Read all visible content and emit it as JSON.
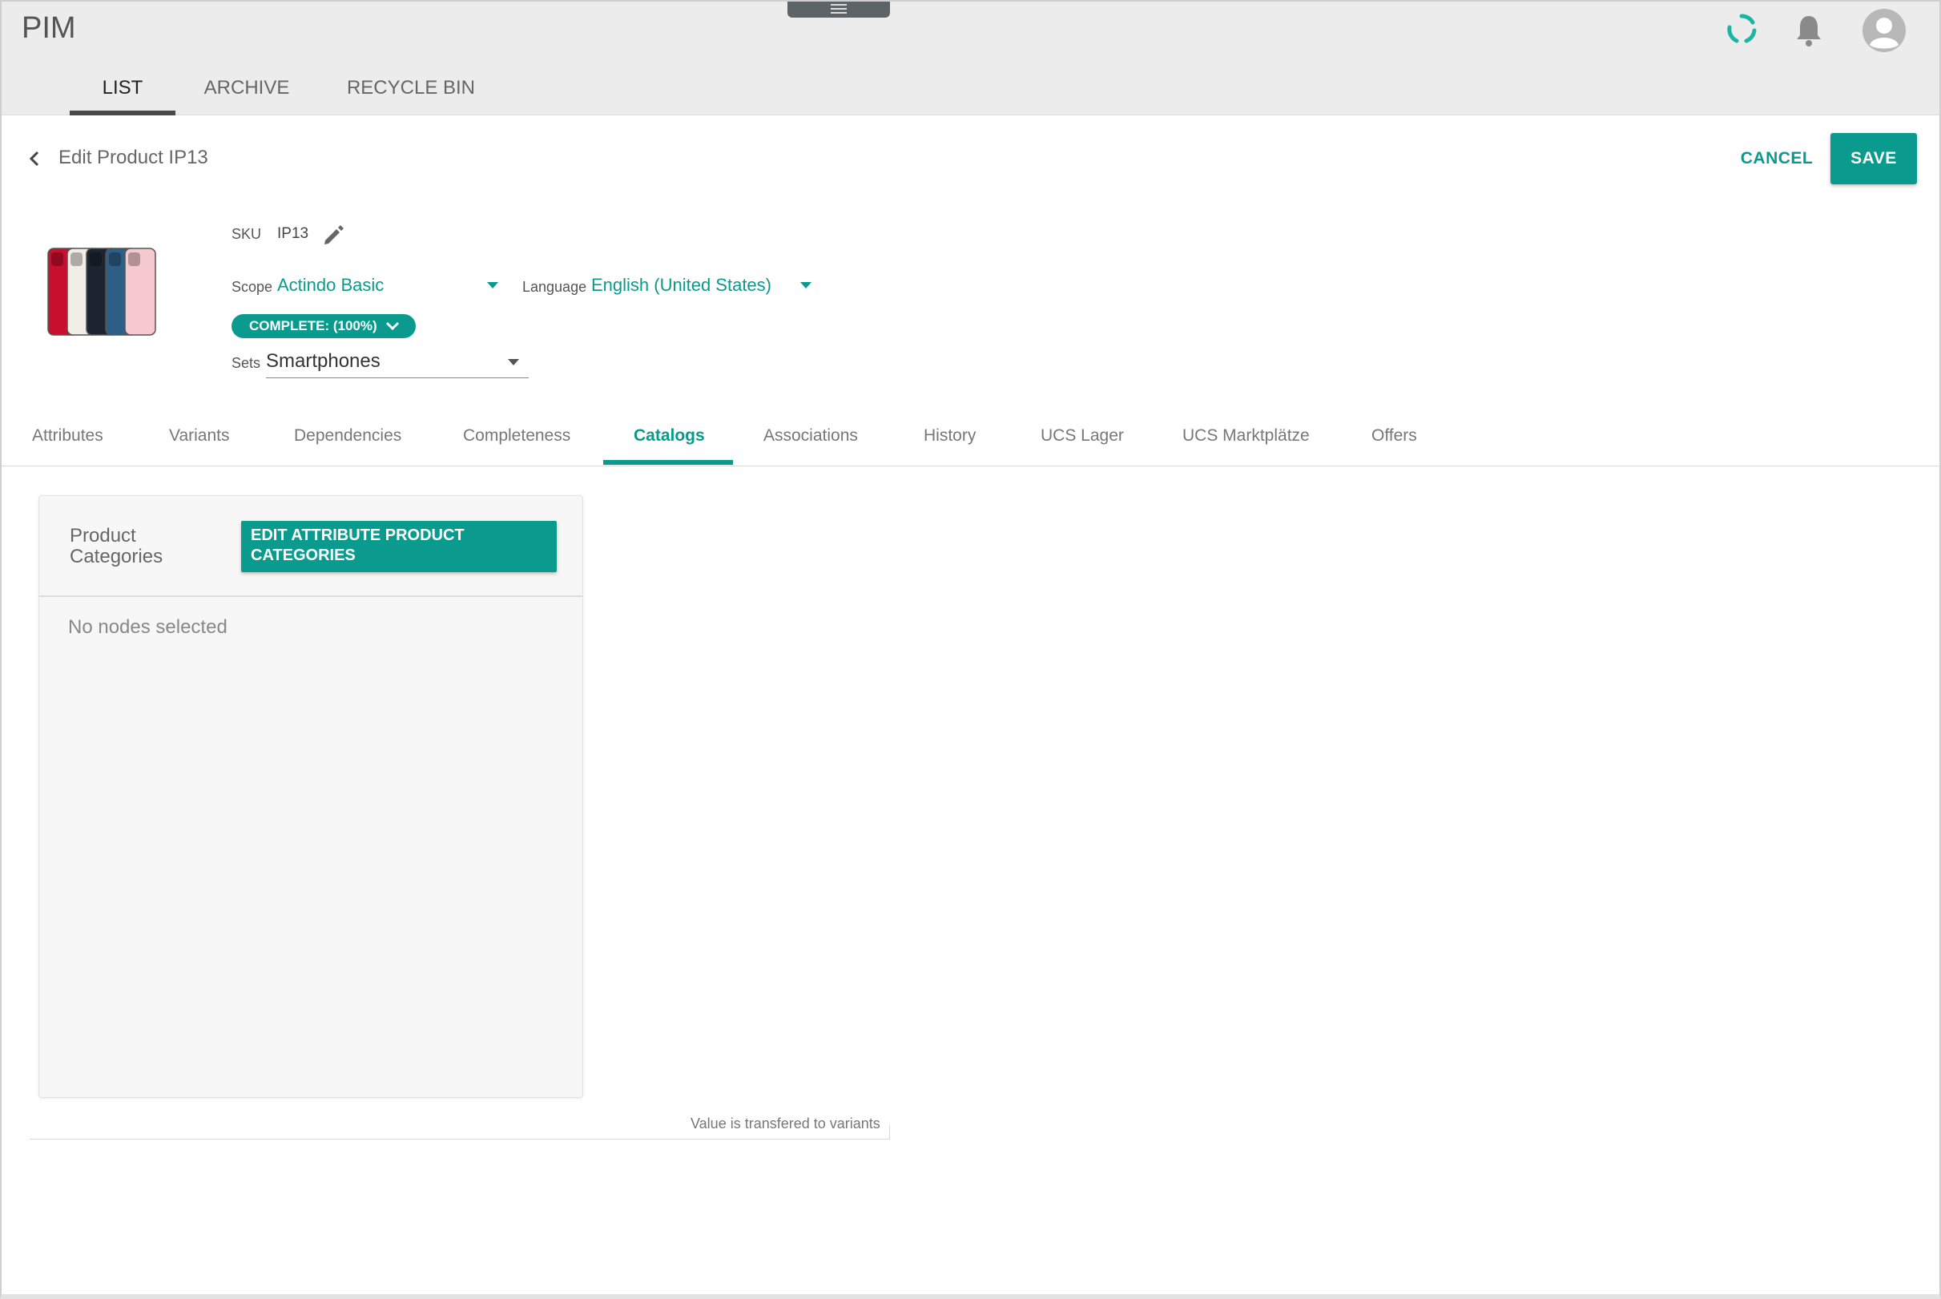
{
  "app": {
    "title": "PIM"
  },
  "header": {
    "icons": [
      "sync-icon",
      "bell-icon",
      "avatar-icon"
    ],
    "tabs": [
      {
        "label": "LIST",
        "active": true
      },
      {
        "label": "ARCHIVE",
        "active": false
      },
      {
        "label": "RECYCLE BIN",
        "active": false
      }
    ]
  },
  "edit": {
    "title": "Edit Product IP13",
    "cancel_label": "CANCEL",
    "save_label": "SAVE"
  },
  "product": {
    "sku_label": "SKU",
    "sku_value": "IP13",
    "scope_label": "Scope",
    "scope_value": "Actindo Basic",
    "language_label": "Language",
    "language_value": "English (United States)",
    "completeness_badge": "COMPLETE: (100%)",
    "sets_label": "Sets",
    "sets_value": "Smartphones",
    "phone_colors": [
      "#c8102e",
      "#f2ede6",
      "#1c2430",
      "#2d5f86",
      "#f6c9cf"
    ]
  },
  "sub_tabs": [
    {
      "label": "Attributes",
      "active": false
    },
    {
      "label": "Variants",
      "active": false
    },
    {
      "label": "Dependencies",
      "active": false
    },
    {
      "label": "Completeness",
      "active": false
    },
    {
      "label": "Catalogs",
      "active": true
    },
    {
      "label": "Associations",
      "active": false
    },
    {
      "label": "History",
      "active": false
    },
    {
      "label": "UCS Lager",
      "active": false
    },
    {
      "label": "UCS Marktplätze",
      "active": false
    },
    {
      "label": "Offers",
      "active": false
    }
  ],
  "catalogs": {
    "field_label": "Product Categories",
    "edit_button_label": "EDIT ATTRIBUTE PRODUCT CATEGORIES",
    "empty_text": "No nodes selected",
    "transfer_note": "Value is transfered to variants"
  },
  "colors": {
    "accent": "#0a9b8e",
    "header_bg": "#ececec"
  }
}
